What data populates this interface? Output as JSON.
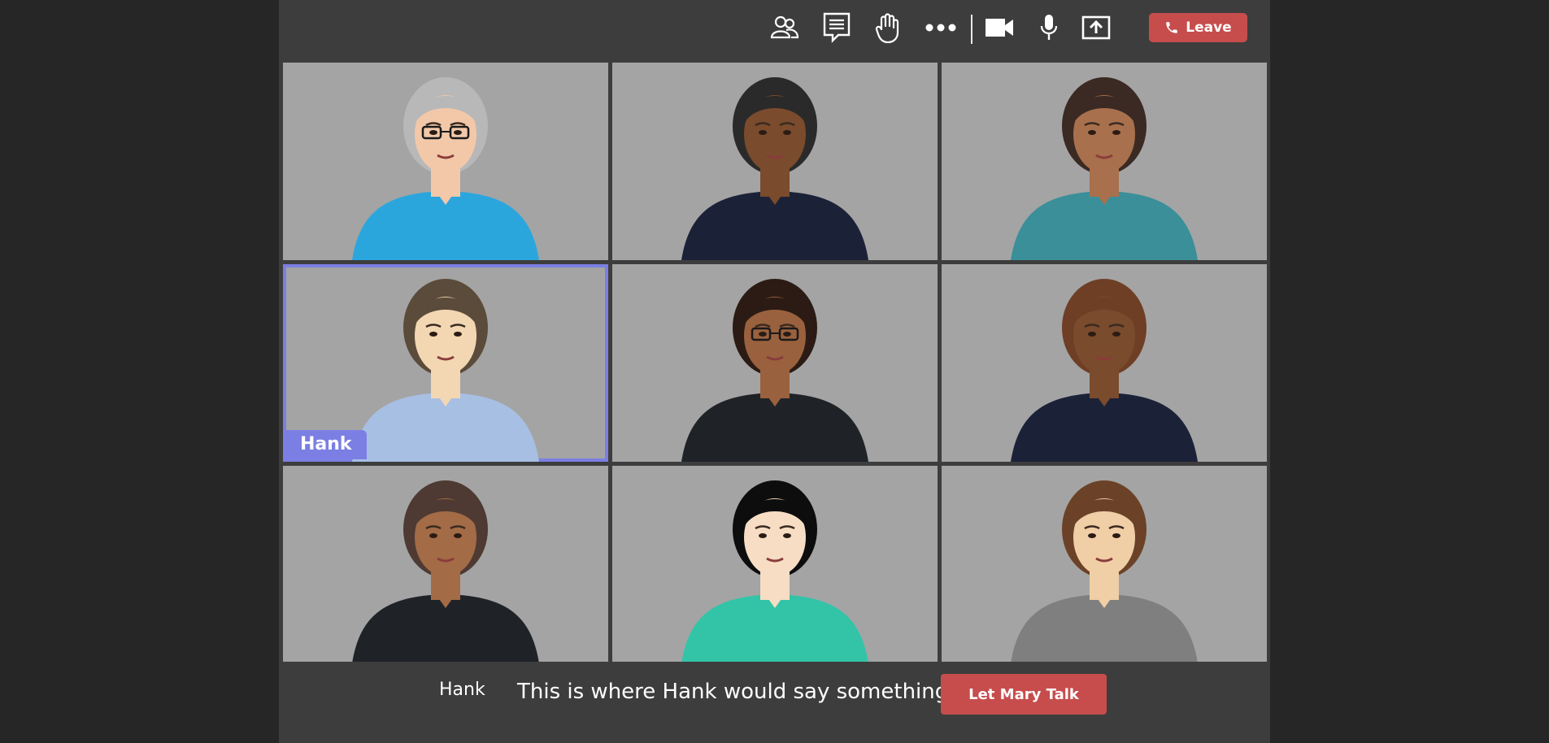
{
  "colors": {
    "accent": "#7b7fe3",
    "danger": "#c74d4d",
    "tile_bg": "#a4a4a4",
    "panel_bg": "#3d3d3d"
  },
  "toolbar": {
    "icons": [
      "people-icon",
      "chat-icon",
      "raise-hand-icon",
      "more-icon",
      "camera-icon",
      "microphone-icon",
      "share-screen-icon"
    ],
    "leave_label": "Leave"
  },
  "participants": [
    {
      "id": "p1",
      "hair": "#b8b8b8",
      "skin": "#f2c8a9",
      "shirt": "#2aa6dd",
      "glasses": true,
      "active": false
    },
    {
      "id": "p2",
      "hair": "#2a2a2a",
      "skin": "#7a4b2c",
      "shirt": "#1b2238",
      "glasses": false,
      "active": false
    },
    {
      "id": "p3",
      "hair": "#3a2a23",
      "skin": "#a8704c",
      "shirt": "#3a8f99",
      "glasses": false,
      "active": false
    },
    {
      "id": "p4",
      "hair": "#5b4b3a",
      "skin": "#f3d7b3",
      "shirt": "#a8bfe4",
      "glasses": false,
      "active": true,
      "name": "Hank"
    },
    {
      "id": "p5",
      "hair": "#2b1b14",
      "skin": "#9a613e",
      "shirt": "#1f2328",
      "glasses": true,
      "active": false
    },
    {
      "id": "p6",
      "hair": "#6e3f25",
      "skin": "#7a4b2c",
      "shirt": "#1b2238",
      "glasses": false,
      "active": false
    },
    {
      "id": "p7",
      "hair": "#4e3a33",
      "skin": "#a36b46",
      "shirt": "#1f2328",
      "glasses": false,
      "active": false
    },
    {
      "id": "p8",
      "hair": "#0d0d0d",
      "skin": "#f6ddc4",
      "shirt": "#33c4a8",
      "glasses": false,
      "active": false
    },
    {
      "id": "p9",
      "hair": "#6b4227",
      "skin": "#f0cea6",
      "shirt": "#7f7f7f",
      "glasses": false,
      "active": false
    }
  ],
  "active_name": "Hank",
  "caption": {
    "speaker": "Hank",
    "text": "This is where Hank would say something.",
    "button_label": "Let Mary Talk"
  }
}
